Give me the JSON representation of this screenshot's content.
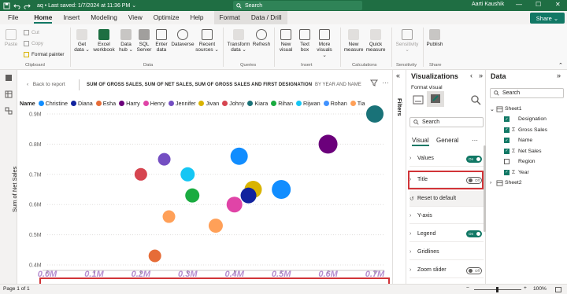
{
  "titlebar": {
    "file_title": "aq • Last saved: 1/7/2024 at 11:36 PM ⌄",
    "search_placeholder": "Search",
    "user": "Aarti Kaushik"
  },
  "menu": {
    "tabs": [
      "File",
      "Home",
      "Insert",
      "Modeling",
      "View",
      "Optimize",
      "Help",
      "Format",
      "Data / Drill"
    ],
    "active": "Home",
    "share": "Share"
  },
  "ribbon": {
    "paste": "Paste",
    "cut": "Cut",
    "copy": "Copy",
    "format_painter": "Format painter",
    "clipboard": "Clipboard",
    "get_data": "Get data ⌄",
    "excel_workbook": "Excel workbook",
    "data_hub": "Data hub ⌄",
    "sql_server": "SQL Server",
    "enter_data": "Enter data",
    "dataverse": "Dataverse",
    "recent_sources": "Recent sources ⌄",
    "data": "Data",
    "transform_data": "Transform data ⌄",
    "refresh": "Refresh",
    "queries": "Queries",
    "new_visual": "New visual",
    "text_box": "Text box",
    "more_visuals": "More visuals ⌄",
    "insert": "Insert",
    "new_measure": "New measure",
    "quick_measure": "Quick measure",
    "calculations": "Calculations",
    "sensitivity": "Sensitivity ⌄",
    "sensitivity_group": "Sensitivity",
    "publish": "Publish",
    "share_group": "Share"
  },
  "report": {
    "back": "Back to report",
    "title": "SUM OF GROSS SALES, SUM OF NET SALES, SUM OF GROSS SALES AND FIRST DESIGNATION",
    "subtitle": "BY YEAR AND NAME",
    "legend_title": "Name"
  },
  "chart_data": {
    "type": "scatter",
    "ylabel": "Sum of Net Sales",
    "xlabel": "",
    "x_ticks": [
      "0.0M",
      "0.1M",
      "0.2M",
      "0.3M",
      "0.4M",
      "0.5M",
      "0.6M",
      "0.7M"
    ],
    "y_ticks": [
      "0.4M",
      "0.5M",
      "0.6M",
      "0.7M",
      "0.8M",
      "0.9M"
    ],
    "xlim": [
      0,
      0.7
    ],
    "ylim": [
      0.4,
      0.9
    ],
    "legend": [
      {
        "name": "Christine",
        "color": "#118dff"
      },
      {
        "name": "Diana",
        "color": "#12239e"
      },
      {
        "name": "Esha",
        "color": "#e66c37"
      },
      {
        "name": "Harry",
        "color": "#6b007b"
      },
      {
        "name": "Henry",
        "color": "#e044a7"
      },
      {
        "name": "Jennifer",
        "color": "#744ec2"
      },
      {
        "name": "Jivan",
        "color": "#d9b300"
      },
      {
        "name": "Johny",
        "color": "#d64550"
      },
      {
        "name": "Kiara",
        "color": "#197278"
      },
      {
        "name": "Rihan",
        "color": "#1aab40"
      },
      {
        "name": "Rijwan",
        "color": "#15c6f4"
      },
      {
        "name": "Rohan",
        "color": "#4092ff"
      },
      {
        "name": "Tia",
        "color": "#ffa058"
      }
    ],
    "points": [
      {
        "x": 0.2,
        "y": 0.7,
        "size": 8,
        "color": "#d64550"
      },
      {
        "x": 0.25,
        "y": 0.75,
        "size": 8,
        "color": "#744ec2"
      },
      {
        "x": 0.3,
        "y": 0.7,
        "size": 9,
        "color": "#15c6f4"
      },
      {
        "x": 0.31,
        "y": 0.63,
        "size": 9,
        "color": "#1aab40"
      },
      {
        "x": 0.26,
        "y": 0.56,
        "size": 8,
        "color": "#ffa058"
      },
      {
        "x": 0.36,
        "y": 0.53,
        "size": 9,
        "color": "#ffa058"
      },
      {
        "x": 0.23,
        "y": 0.43,
        "size": 8,
        "color": "#e66c37"
      },
      {
        "x": 0.41,
        "y": 0.76,
        "size": 11,
        "color": "#118dff"
      },
      {
        "x": 0.4,
        "y": 0.6,
        "size": 10,
        "color": "#e044a7"
      },
      {
        "x": 0.44,
        "y": 0.65,
        "size": 11,
        "color": "#d9b300"
      },
      {
        "x": 0.43,
        "y": 0.63,
        "size": 10,
        "color": "#12239e"
      },
      {
        "x": 0.5,
        "y": 0.65,
        "size": 12,
        "color": "#118dff"
      },
      {
        "x": 0.6,
        "y": 0.8,
        "size": 12,
        "color": "#6b007b"
      },
      {
        "x": 0.7,
        "y": 0.9,
        "size": 11,
        "color": "#197278"
      }
    ]
  },
  "visualizations": {
    "title": "Visualizations",
    "format_visual": "Format visual",
    "search_placeholder": "Search",
    "tabs": [
      "Visual",
      "General"
    ],
    "more": "···",
    "rows": [
      {
        "label": "Values",
        "toggle": "On"
      },
      {
        "label": "Title",
        "toggle": "Off"
      },
      {
        "label": "Reset to default"
      },
      {
        "label": "Y-axis"
      },
      {
        "label": "Legend",
        "toggle": "On"
      },
      {
        "label": "Gridlines"
      },
      {
        "label": "Zoom slider",
        "toggle": "Off"
      }
    ]
  },
  "filters": {
    "label": "Filters"
  },
  "data_pane": {
    "title": "Data",
    "search_placeholder": "Search",
    "table": "Sheet1",
    "fields": [
      {
        "label": "Designation",
        "checked": true,
        "sigma": false
      },
      {
        "label": "Gross Sales",
        "checked": true,
        "sigma": true
      },
      {
        "label": "Name",
        "checked": true,
        "sigma": false
      },
      {
        "label": "Net Sales",
        "checked": true,
        "sigma": true
      },
      {
        "label": "Region",
        "checked": false,
        "sigma": false
      },
      {
        "label": "Year",
        "checked": true,
        "sigma": true
      }
    ],
    "table2": "Sheet2"
  },
  "status": {
    "page": "Page 1 of 1",
    "zoom": "100%"
  }
}
